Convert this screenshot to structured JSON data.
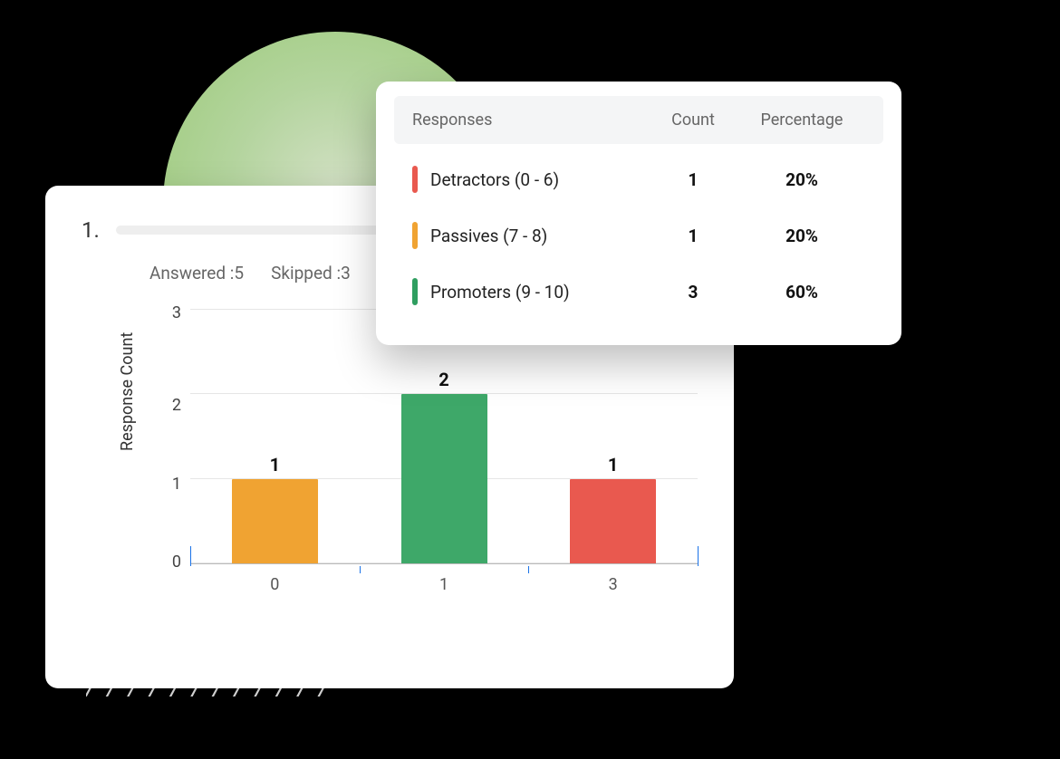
{
  "question_number": "1.",
  "meta": {
    "answered_label": "Answered :",
    "answered_value": "5",
    "skipped_label": "Skipped :",
    "skipped_value": "3"
  },
  "table": {
    "headers": {
      "responses": "Responses",
      "count": "Count",
      "percentage": "Percentage"
    },
    "rows": [
      {
        "color": "#e9594f",
        "label": "Detractors (0 - 6)",
        "count": "1",
        "pct": "20%"
      },
      {
        "color": "#f0a332",
        "label": "Passives (7 - 8)",
        "count": "1",
        "pct": "20%"
      },
      {
        "color": "#2f9e60",
        "label": "Promoters (9 - 10)",
        "count": "3",
        "pct": "60%"
      }
    ]
  },
  "chart_data": {
    "type": "bar",
    "title": "",
    "xlabel": "",
    "ylabel": "Response Count",
    "ylim": [
      0,
      3
    ],
    "yticks": [
      0,
      1,
      2,
      3
    ],
    "categories": [
      "0",
      "1",
      "3"
    ],
    "values": [
      1,
      2,
      1
    ],
    "colors": [
      "#f0a332",
      "#3ea869",
      "#e9594f"
    ]
  },
  "hatch_text": "/ / / / / / / / / / / /"
}
